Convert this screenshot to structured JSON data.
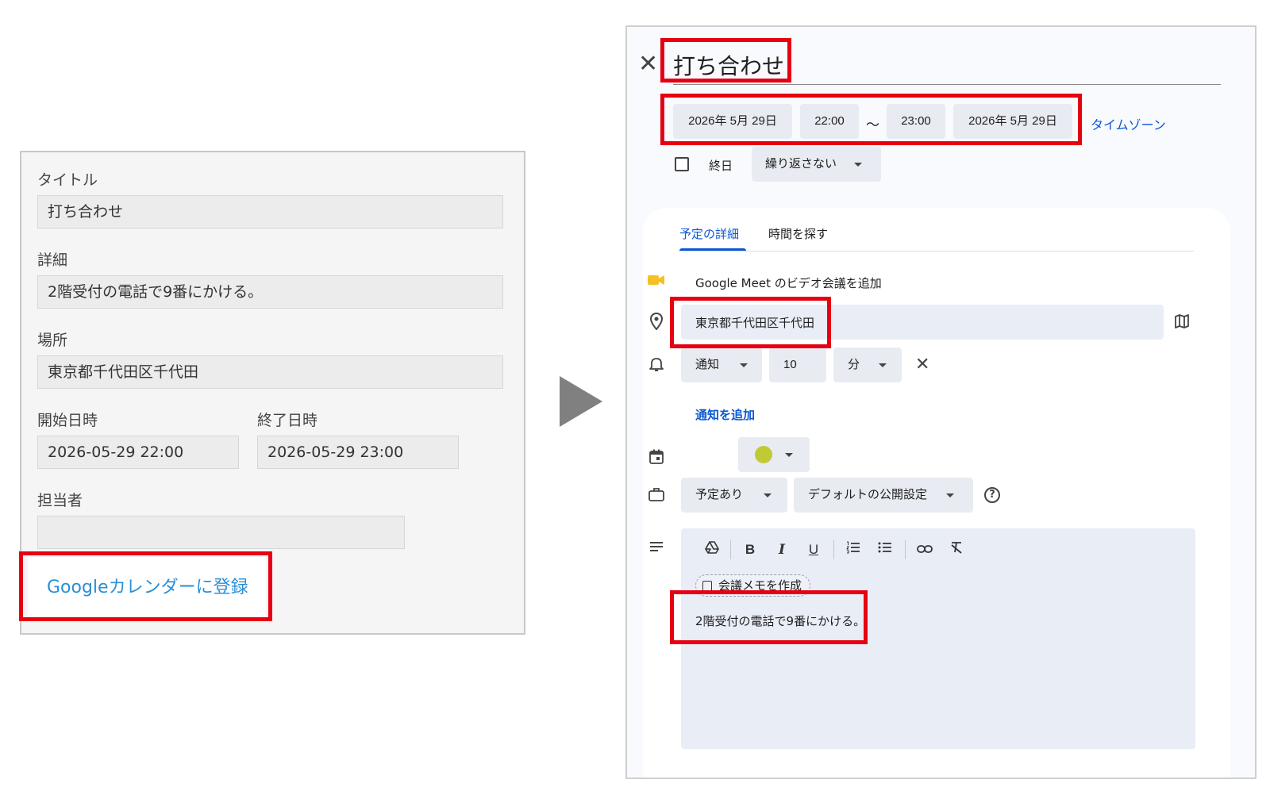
{
  "form": {
    "title_label": "タイトル",
    "title_value": "打ち合わせ",
    "detail_label": "詳細",
    "detail_value": "2階受付の電話で9番にかける。",
    "location_label": "場所",
    "location_value": "東京都千代田区千代田",
    "start_label": "開始日時",
    "start_value": "2026-05-29 22:00",
    "end_label": "終了日時",
    "end_value": "2026-05-29 23:00",
    "assignee_label": "担当者",
    "assignee_value": "",
    "gcal_button": "Googleカレンダーに登録"
  },
  "calendar": {
    "close_icon": "✕",
    "event_title": "打ち合わせ",
    "start_date": "2026年 5月 29日",
    "start_time": "22:00",
    "tilde": "〜",
    "end_time": "23:00",
    "end_date": "2026年 5月 29日",
    "timezone_link": "タイムゾーン",
    "allday_label": "終日",
    "repeat_select": "繰り返さない",
    "tabs": [
      "予定の詳細",
      "時間を探す"
    ],
    "meet_label": "Google Meet のビデオ会議を追加",
    "location_value": "東京都千代田区千代田",
    "notify_type": "通知",
    "notify_value": "10",
    "notify_unit": "分",
    "add_notification": "通知を追加",
    "busy_select": "予定あり",
    "visibility_select": "デフォルトの公開設定",
    "help_glyph": "?",
    "memo_chip": "会議メモを作成",
    "description_value": "2階受付の電話で9番にかける。",
    "event_color": "#c0ca33",
    "toolbar": {
      "bold": "B",
      "italic": "I",
      "underline": "U"
    }
  },
  "colors": {
    "highlight": "#e60012",
    "link": "#0b57d0",
    "gcal_link": "#2a8fd6"
  }
}
